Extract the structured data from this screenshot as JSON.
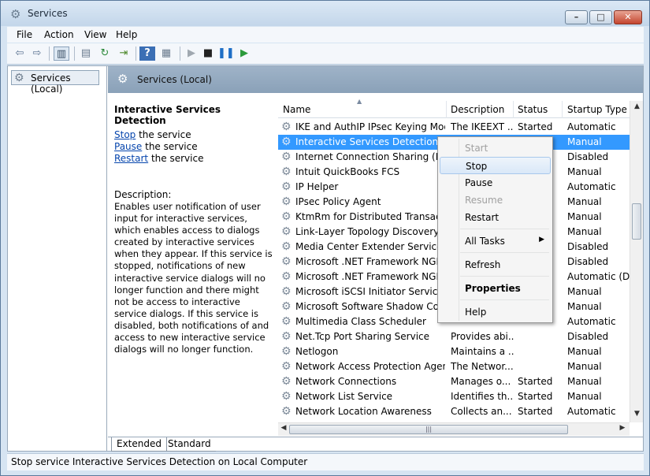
{
  "window": {
    "title": "Services"
  },
  "menu": [
    "File",
    "Action",
    "View",
    "Help"
  ],
  "toolbar": [
    "back-arrow-icon",
    "forward-arrow-icon",
    "show-hide-console-tree-icon",
    "export-list-icon",
    "refresh-icon",
    "export-icon",
    "help-icon",
    "properties-icon",
    "start-service-icon",
    "stop-service-icon",
    "pause-service-icon",
    "restart-service-icon"
  ],
  "tree": {
    "root": "Services (Local)"
  },
  "pane": {
    "header": "Services (Local)"
  },
  "detail": {
    "title": "Interactive Services Detection",
    "stop_link": "Stop",
    "stop_rest": " the service",
    "pause_link": "Pause",
    "pause_rest": " the service",
    "restart_link": "Restart",
    "restart_rest": " the service",
    "description_label": "Description:",
    "description": "Enables user notification of user input for interactive services, which enables access to dialogs created by interactive services when they appear. If this service is stopped, notifications of new interactive service dialogs will no longer function and there might not be access to interactive service dialogs. If this service is disabled, both notifications of and access to new interactive service dialogs will no longer function."
  },
  "columns": {
    "name": "Name",
    "description": "Description",
    "status": "Status",
    "startup": "Startup Type"
  },
  "rows": [
    {
      "name": "IKE and AuthIP IPsec Keying Mod...",
      "description": "The IKEEXT ...",
      "status": "Started",
      "startup": "Automatic"
    },
    {
      "name": "Interactive Services Detection",
      "description": "",
      "status": "",
      "startup": "Manual"
    },
    {
      "name": "Internet Connection Sharing (ICS)",
      "description": "",
      "status": "",
      "startup": "Disabled"
    },
    {
      "name": "Intuit QuickBooks FCS",
      "description": "",
      "status": "",
      "startup": "Manual"
    },
    {
      "name": "IP Helper",
      "description": "",
      "status": "",
      "startup": "Automatic"
    },
    {
      "name": "IPsec Policy Agent",
      "description": "",
      "status": "",
      "startup": "Manual"
    },
    {
      "name": "KtmRm for Distributed Transactio...",
      "description": "",
      "status": "",
      "startup": "Manual"
    },
    {
      "name": "Link-Layer Topology Discovery M...",
      "description": "",
      "status": "",
      "startup": "Manual"
    },
    {
      "name": "Media Center Extender Service",
      "description": "",
      "status": "",
      "startup": "Disabled"
    },
    {
      "name": "Microsoft .NET Framework NGEN ...",
      "description": "",
      "status": "",
      "startup": "Disabled"
    },
    {
      "name": "Microsoft .NET Framework NGEN ...",
      "description": "",
      "status": "",
      "startup": "Automatic (D..."
    },
    {
      "name": "Microsoft iSCSI Initiator Service",
      "description": "",
      "status": "",
      "startup": "Manual"
    },
    {
      "name": "Microsoft Software Shadow Copy ...",
      "description": "",
      "status": "",
      "startup": "Manual"
    },
    {
      "name": "Multimedia Class Scheduler",
      "description": "",
      "status": "",
      "startup": "Automatic"
    },
    {
      "name": "Net.Tcp Port Sharing Service",
      "description": "Provides abi...",
      "status": "",
      "startup": "Disabled"
    },
    {
      "name": "Netlogon",
      "description": "Maintains a ...",
      "status": "",
      "startup": "Manual"
    },
    {
      "name": "Network Access Protection Agent",
      "description": "The Networ...",
      "status": "",
      "startup": "Manual"
    },
    {
      "name": "Network Connections",
      "description": "Manages o...",
      "status": "Started",
      "startup": "Manual"
    },
    {
      "name": "Network List Service",
      "description": "Identifies th...",
      "status": "Started",
      "startup": "Manual"
    },
    {
      "name": "Network Location Awareness",
      "description": "Collects an...",
      "status": "Started",
      "startup": "Automatic"
    }
  ],
  "context_menu": {
    "start": "Start",
    "stop": "Stop",
    "pause": "Pause",
    "resume": "Resume",
    "restart": "Restart",
    "all_tasks": "All Tasks",
    "refresh": "Refresh",
    "properties": "Properties",
    "help": "Help"
  },
  "tabs": {
    "extended": "Extended",
    "standard": "Standard"
  },
  "status_bar": "Stop service Interactive Services Detection on Local Computer",
  "colors": {
    "selection": "#3399ff",
    "header_band": "#9fb3c8",
    "link": "#0645ad"
  }
}
